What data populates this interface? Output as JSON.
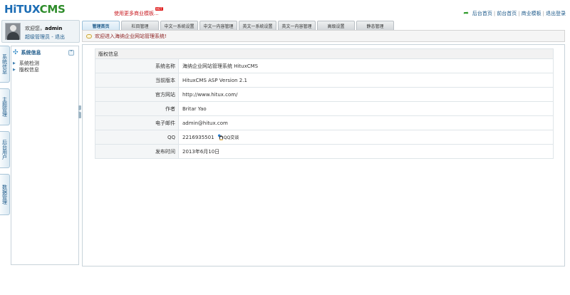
{
  "header": {
    "logo_part1": "HiTUX",
    "logo_part2": "CMS",
    "promo": "使用更多商业模板...",
    "hot_badge": "HOT",
    "links": [
      "后台首页",
      "前台首页",
      "商业模板",
      "退出登录"
    ],
    "link_separator": "|"
  },
  "user": {
    "welcome_prefix": "欢迎您，",
    "name": "admin",
    "role": "超级管理员",
    "role_sep": " - ",
    "logout": "退出"
  },
  "tabs": [
    {
      "label": "管理首页",
      "active": true
    },
    {
      "label": "栏目管理"
    },
    {
      "label": "中文一系统设置"
    },
    {
      "label": "中文一内容管理"
    },
    {
      "label": "英文一系统设置"
    },
    {
      "label": "英文一内容管理"
    },
    {
      "label": "高级设置"
    },
    {
      "label": "静态管理"
    }
  ],
  "notice": "欢迎进入海纳企业网站管理系统!",
  "side_tabs": [
    "系统信息",
    "主题管理",
    "后台用户",
    "数据管理"
  ],
  "menu": {
    "title": "系统信息",
    "collapse_symbol": "⌃",
    "items": [
      "系统检测",
      "版权信息"
    ]
  },
  "info": {
    "heading": "版权信息",
    "rows": [
      {
        "label": "系统名称",
        "value": "海纳企业网站管理系统 HituxCMS"
      },
      {
        "label": "当前版本",
        "value": "HituxCMS ASP Version 2.1"
      },
      {
        "label": "官方网站",
        "value": "http://www.hitux.com/"
      },
      {
        "label": "作者",
        "value": "Britar Yao"
      },
      {
        "label": "电子邮件",
        "value": "admin@hitux.com"
      },
      {
        "label": "QQ",
        "value": "2216935501",
        "extra": "QQ交谈"
      },
      {
        "label": "发布时间",
        "value": "2013年6月10日"
      }
    ]
  },
  "colors": {
    "accent_blue": "#1d5a8a",
    "logo_green": "#2e8c2a",
    "notice_red": "#8a1c1c",
    "promo_red": "#c8171e"
  }
}
